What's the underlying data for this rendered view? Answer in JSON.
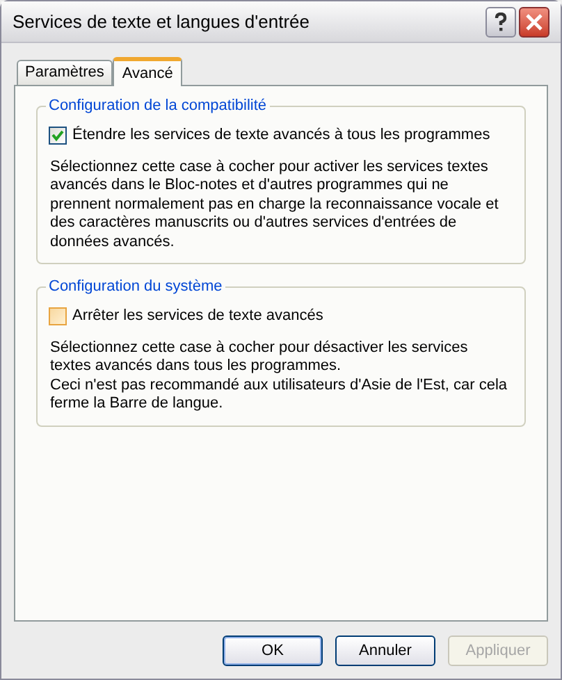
{
  "window": {
    "title": "Services de texte et langues d'entrée"
  },
  "title_buttons": [
    {
      "kind": "help"
    },
    {
      "kind": "close"
    }
  ],
  "tabs": [
    {
      "label": "Paramètres",
      "selected": false
    },
    {
      "label": "Avancé",
      "selected": true
    }
  ],
  "groups": [
    {
      "title": "Configuration de la compatibilité",
      "checkbox": {
        "label": "Étendre les services de texte avancés à tous les programmes",
        "checked": true
      },
      "paragraphs": [
        "Sélectionnez cette case à cocher pour activer les services textes avancés dans le Bloc-notes et d'autres programmes qui ne prennent normalement pas en charge la reconnaissance vocale et des caractères manuscrits ou d'autres services d'entrées de données avancés."
      ]
    },
    {
      "title": "Configuration du système",
      "checkbox": {
        "label": "Arrêter les services de texte avancés",
        "checked": false
      },
      "paragraphs": [
        "Sélectionnez cette case à cocher pour désactiver les services textes avancés dans tous les programmes.",
        "Ceci n'est pas recommandé aux utilisateurs d'Asie de l'Est, car cela ferme la Barre de langue."
      ]
    }
  ],
  "buttons": [
    {
      "label": "OK",
      "disabled": false,
      "default": true
    },
    {
      "label": "Annuler",
      "disabled": false,
      "default": false
    },
    {
      "label": "Appliquer",
      "disabled": true,
      "default": false
    }
  ]
}
